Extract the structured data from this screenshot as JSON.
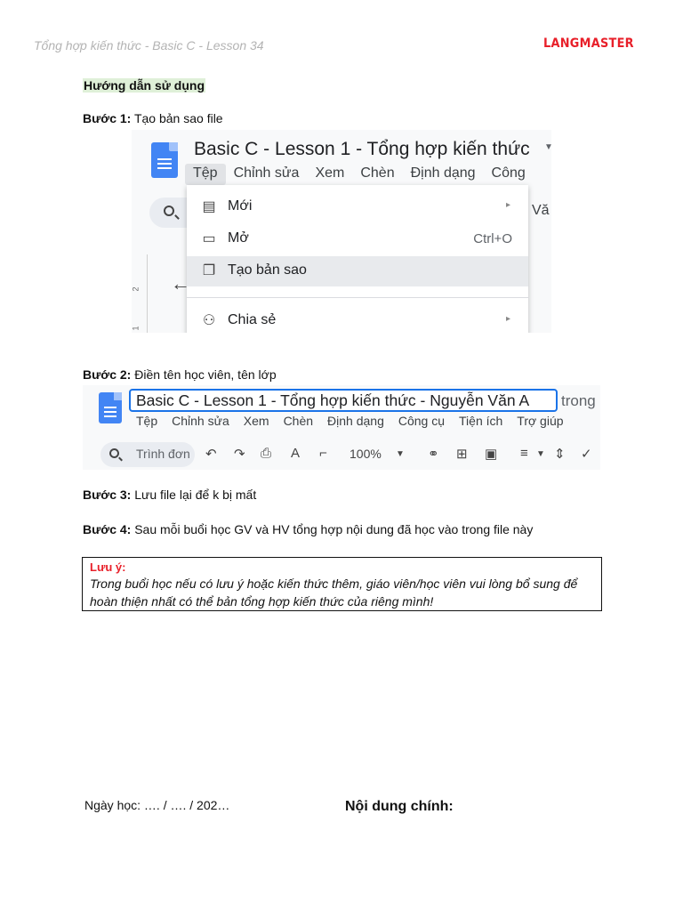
{
  "header": {
    "title": "Tổng hợp kiến thức - Basic C - Lesson 34",
    "brand": "LANGMASTER"
  },
  "guide": {
    "heading": "Hướng dẫn sử dụng",
    "steps": [
      {
        "label": "Bước 1:",
        "text": " Tạo bản sao file"
      },
      {
        "label": "Bước 2:",
        "text": " Điền tên học viên, tên lớp"
      },
      {
        "label": "Bước 3:",
        "text": " Lưu file lại để k bị mất"
      },
      {
        "label": "Bước 4:",
        "text": " Sau mỗi buổi học GV và HV tổng hợp nội dung đã học vào trong file này"
      }
    ]
  },
  "screenshot1": {
    "doc_title": "Basic C - Lesson 1 - Tổng hợp kiến thức",
    "menu": [
      "Tệp",
      "Chỉnh sửa",
      "Xem",
      "Chèn",
      "Định dạng",
      "Công"
    ],
    "right_fragment": "Vă",
    "ruler_marks": [
      "2",
      "1"
    ],
    "dropdown": [
      {
        "icon": "document-icon",
        "label": "Mới",
        "aux": "▸"
      },
      {
        "icon": "folder-icon",
        "label": "Mở",
        "aux": "Ctrl+O"
      },
      {
        "icon": "copy-icon",
        "label": "Tạo bản sao",
        "aux": ""
      },
      {
        "icon": "share-person-icon",
        "label": "Chia sẻ",
        "aux": "▸"
      }
    ]
  },
  "screenshot2": {
    "doc_title": "Basic C - Lesson 1 - Tổng hợp kiến thức - Nguyễn Văn A",
    "after_title": "trong",
    "menu": [
      "Tệp",
      "Chỉnh sửa",
      "Xem",
      "Chèn",
      "Định dạng",
      "Công cụ",
      "Tiện ích",
      "Trợ giúp"
    ],
    "search_label": "Trình đơn",
    "zoom": "100%"
  },
  "note": {
    "title": "Lưu ý:",
    "body": "Trong buổi học nếu có lưu ý hoặc kiến thức thêm, giáo viên/học viên vui lòng bổ sung để hoàn thiện nhất có thể bản tổng hợp kiến thức của riêng mình!"
  },
  "footer": {
    "study_date": "Ngày học: …. / …. / 202…",
    "main_content": "Nội dung chính:"
  }
}
